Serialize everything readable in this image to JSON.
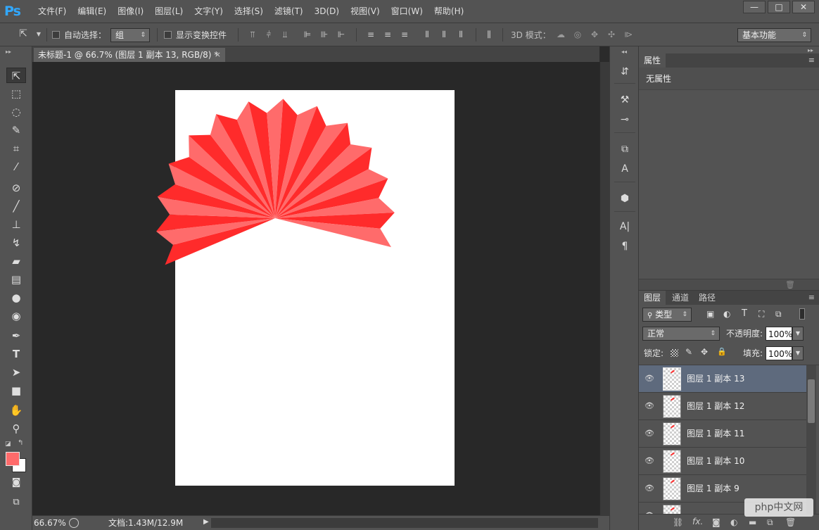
{
  "app": {
    "logo": "Ps"
  },
  "menu": [
    "文件(F)",
    "编辑(E)",
    "图像(I)",
    "图层(L)",
    "文字(Y)",
    "选择(S)",
    "滤镜(T)",
    "3D(D)",
    "视图(V)",
    "窗口(W)",
    "帮助(H)"
  ],
  "window_controls": {
    "minimize": "—",
    "maximize": "□",
    "close": "✕"
  },
  "options": {
    "auto_select_label": "自动选择：",
    "auto_select_value": "组",
    "show_transform_label": "显示变换控件",
    "mode_3d_label": "3D 模式：",
    "workspace": "基本功能"
  },
  "document": {
    "tab_title": "未标题-1 @ 66.7% (图层 1 副本 13, RGB/8) *",
    "tab_close": "×",
    "zoom": "66.67%",
    "doc_size": "文档:1.43M/12.9M"
  },
  "properties": {
    "tab": "属性",
    "empty_text": "无属性"
  },
  "layers_panel": {
    "tabs": [
      "图层",
      "通道",
      "路径"
    ],
    "filter_kind": "类型",
    "blend_mode": "正常",
    "opacity_label": "不透明度:",
    "opacity_value": "100%",
    "lock_label": "锁定:",
    "fill_label": "填充:",
    "fill_value": "100%",
    "layers": [
      {
        "name": "图层 1 副本 13",
        "selected": true
      },
      {
        "name": "图层 1 副本 12",
        "selected": false
      },
      {
        "name": "图层 1 副本 11",
        "selected": false
      },
      {
        "name": "图层 1 副本 10",
        "selected": false
      },
      {
        "name": "图层 1 副本 9",
        "selected": false
      }
    ]
  },
  "watermark": "php中文网",
  "colors": {
    "foreground": "#ff6b6b",
    "background": "#ffffff",
    "fan_red": "#ff2b2b",
    "fan_pink": "#ff6b6b",
    "selected_layer": "#5e6a7d"
  }
}
